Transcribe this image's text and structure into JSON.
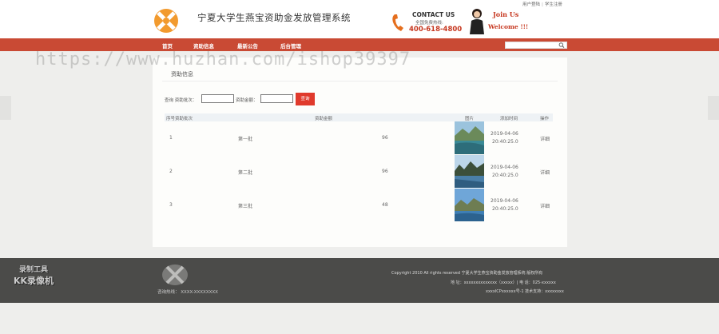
{
  "header": {
    "site_title": "宁夏大学生燕宝资助金发放管理系统",
    "contact_title": "CONTACT US",
    "contact_sub": "全国免费热线:",
    "contact_phone": "400-618-4800",
    "join_title": "Join Us",
    "welcome": "Welcome !!!",
    "user_login": "用户登陆",
    "student_register": "学生注册"
  },
  "nav": {
    "items": [
      "首页",
      "资助信息",
      "最新公告",
      "后台管理"
    ],
    "search_placeholder": ""
  },
  "watermark": "https://www.huzhan.com/ishop39397",
  "panel": {
    "title": "资助信息",
    "filter": {
      "label_batch": "查询 资助批次：",
      "label_amount": "资助金额：",
      "batch_value": "",
      "amount_value": "",
      "button": "查询"
    },
    "columns": [
      "序号资助批次",
      "资助金额",
      "图片",
      "添加时间",
      "操作"
    ],
    "rows": [
      {
        "index": "1",
        "batch": "第一批",
        "amount": "96",
        "date": "2019-04-06",
        "time": "20:40:25.0",
        "action": "详细"
      },
      {
        "index": "2",
        "batch": "第二批",
        "amount": "96",
        "date": "2019-04-06",
        "time": "20:40:25.0",
        "action": "详细"
      },
      {
        "index": "3",
        "batch": "第三批",
        "amount": "48",
        "date": "2019-04-06",
        "time": "20:40:25.0",
        "action": "详细"
      }
    ]
  },
  "footer": {
    "rec_tool": "录制工具",
    "rec_name": "KK录像机",
    "hotline": "咨询热线：  XXXX-XXXXXXXX",
    "copyright": "Copyright 2010 All rights reserved 宁夏大学生燕宝资助金发放管理系统 版权所有",
    "address": "地    址：xxxxxxxxxxxxxx（xxxxx）| 电    话：025-xxxxxx",
    "icp": "xxxxICPxxxxxx号-1 技术支持：xxxxxxxx"
  },
  "colors": {
    "nav_bg": "#c94a34",
    "accent": "#e03a2c",
    "footer_bg": "#4b4b49"
  }
}
